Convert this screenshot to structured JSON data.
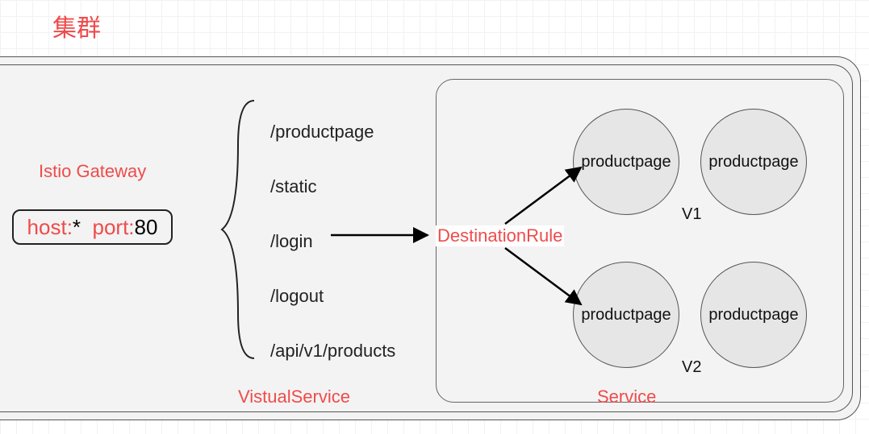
{
  "title": "集群",
  "gateway": {
    "label": "Istio Gateway",
    "host_key": "host:",
    "host_value": "*",
    "port_key": "port:",
    "port_value": "80"
  },
  "virtual_service": {
    "label": "VistualService",
    "routes": [
      "/productpage",
      "/static",
      "/login",
      "/logout",
      "/api/v1/products"
    ]
  },
  "destination_rule": {
    "label": "DestinationRule"
  },
  "service": {
    "label": "Service",
    "versions": [
      {
        "name": "V1",
        "pods": [
          "productpage",
          "productpage"
        ]
      },
      {
        "name": "V2",
        "pods": [
          "productpage",
          "productpage"
        ]
      }
    ]
  },
  "chart_data": {
    "type": "table",
    "title": "Istio traffic-routing diagram",
    "nodes": [
      {
        "id": "gateway",
        "label": "Istio Gateway",
        "host": "*",
        "port": 80
      },
      {
        "id": "vs",
        "label": "VistualService",
        "routes": [
          "/productpage",
          "/static",
          "/login",
          "/logout",
          "/api/v1/products"
        ]
      },
      {
        "id": "dr",
        "label": "DestinationRule"
      },
      {
        "id": "svc",
        "label": "Service",
        "subsets": [
          {
            "version": "V1",
            "pods": [
              "productpage",
              "productpage"
            ]
          },
          {
            "version": "V2",
            "pods": [
              "productpage",
              "productpage"
            ]
          }
        ]
      }
    ],
    "edges": [
      {
        "from": "gateway",
        "to": "vs"
      },
      {
        "from": "vs.route./login",
        "to": "dr"
      },
      {
        "from": "dr",
        "to": "svc.V1"
      },
      {
        "from": "dr",
        "to": "svc.V2"
      }
    ]
  }
}
